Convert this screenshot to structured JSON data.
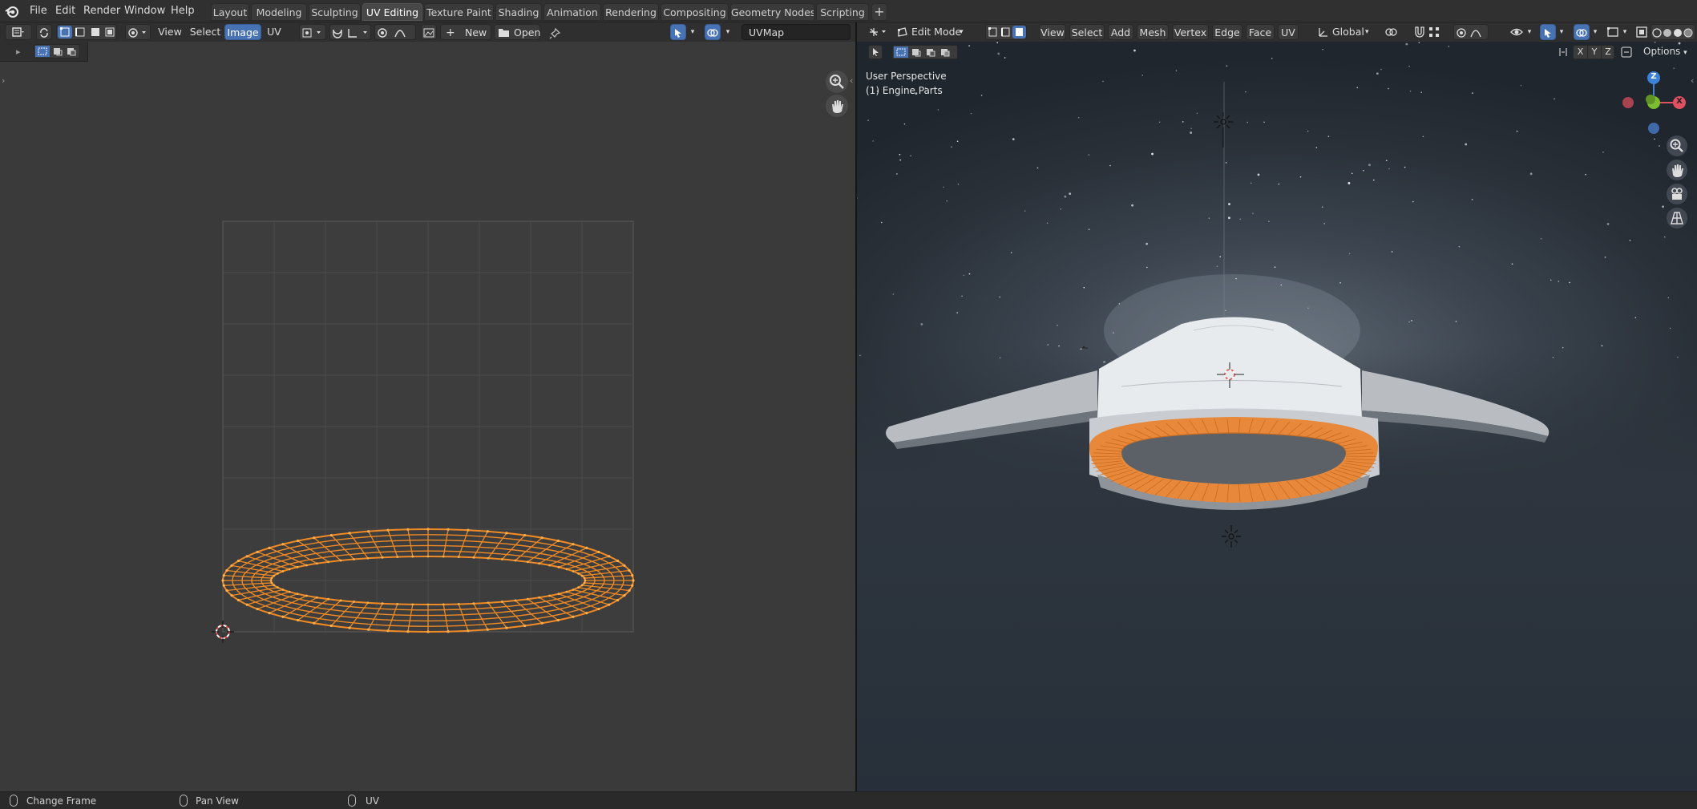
{
  "topbar": {
    "menus": [
      "File",
      "Edit",
      "Render",
      "Window",
      "Help"
    ],
    "workspaces": [
      "Layout",
      "Modeling",
      "Sculpting",
      "UV Editing",
      "Texture Paint",
      "Shading",
      "Animation",
      "Rendering",
      "Compositing",
      "Geometry Nodes",
      "Scripting"
    ],
    "active_workspace": "UV Editing",
    "add_label": "+"
  },
  "uv_header": {
    "view": "View",
    "select": "Select",
    "image": "Image",
    "uv": "UV",
    "new": "New",
    "open": "Open",
    "uvmap": "UVMap"
  },
  "viewport_header": {
    "mode": "Edit Mode",
    "view": "View",
    "select": "Select",
    "add": "Add",
    "mesh": "Mesh",
    "vertex": "Vertex",
    "edge": "Edge",
    "face": "Face",
    "uv": "UV",
    "orientation": "Global",
    "options": "Options",
    "axes": [
      "X",
      "Y",
      "Z"
    ]
  },
  "viewport": {
    "perspective": "User Perspective",
    "object": "(1) Engine Parts",
    "gizmo": {
      "x": "X",
      "y": "Y",
      "z": "Z"
    }
  },
  "statusbar": {
    "left": "Change Frame",
    "middle": "Pan View",
    "right": "UV"
  },
  "colors": {
    "accent": "#4772b3",
    "selection_orange": "#f08a24",
    "axis_x": "#e05060",
    "axis_y": "#7cbc30",
    "axis_z": "#3c82d8"
  }
}
